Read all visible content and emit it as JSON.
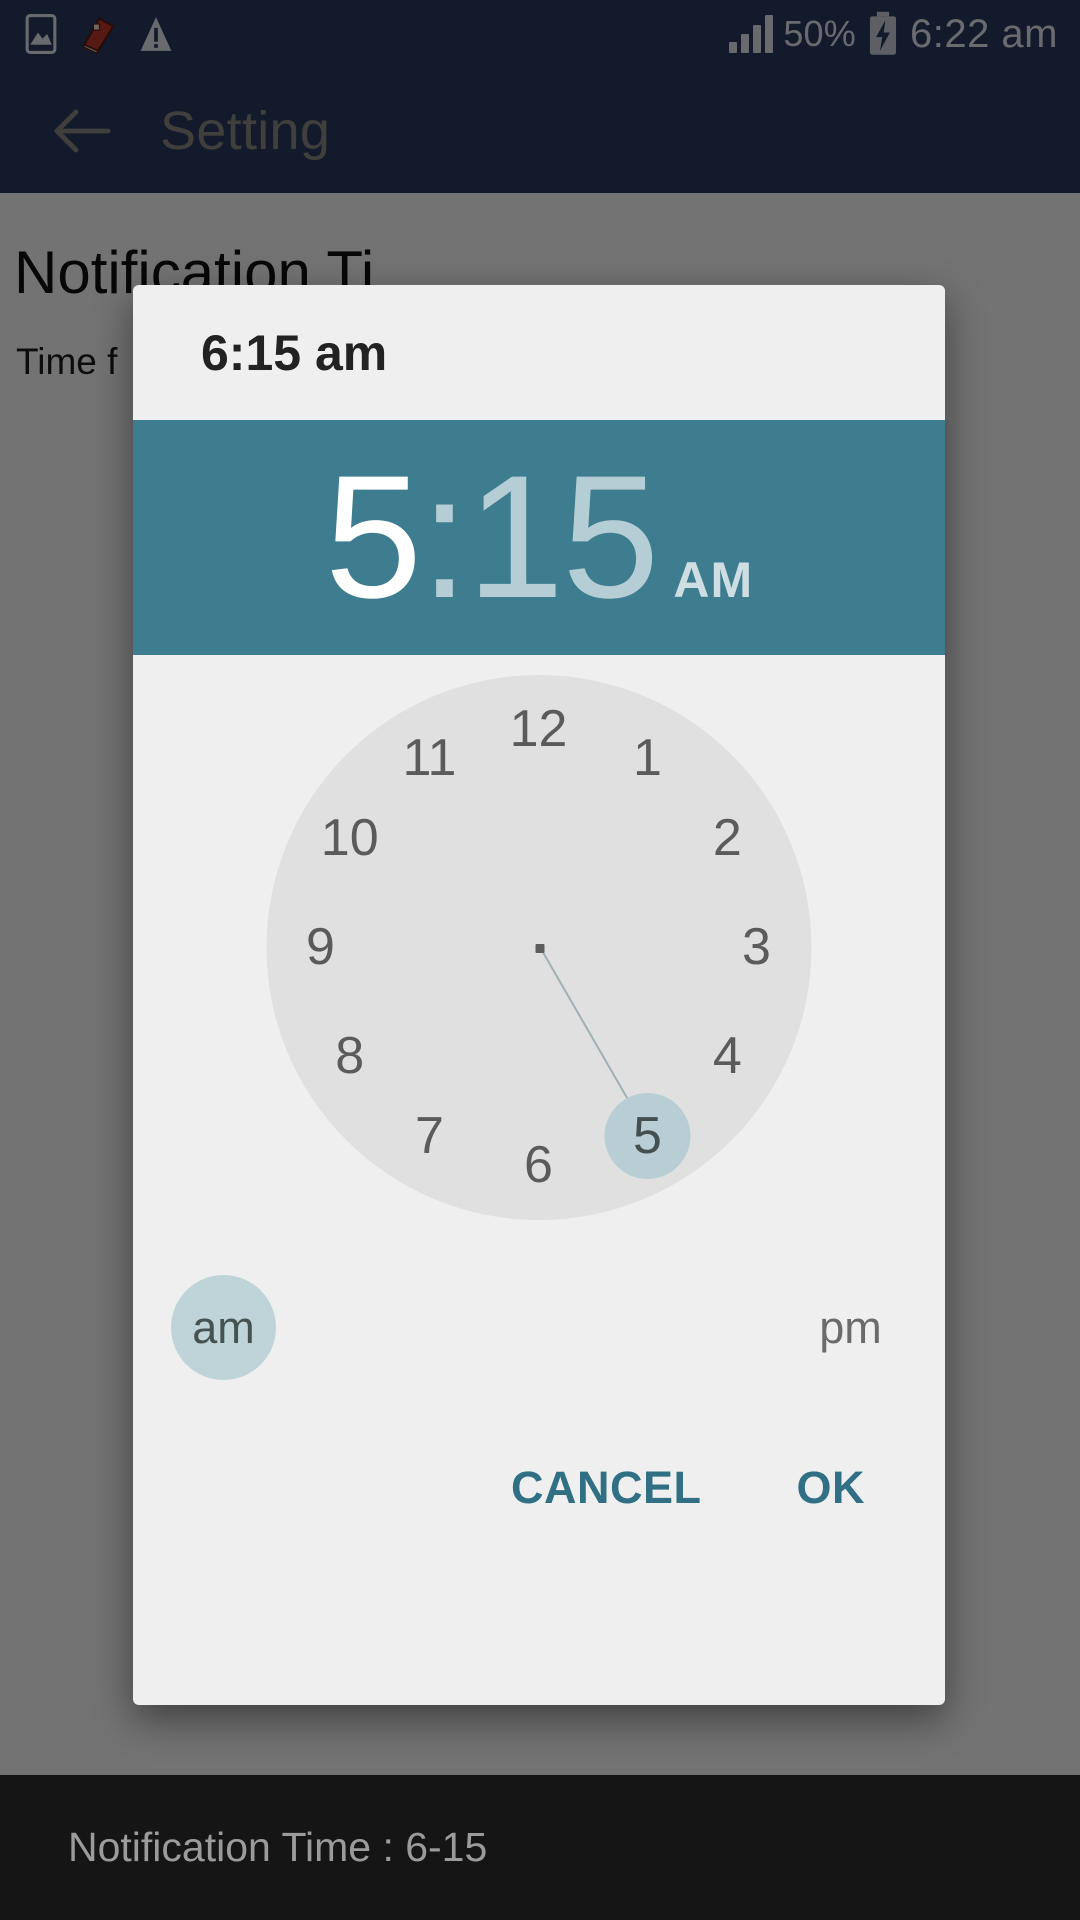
{
  "statusbar": {
    "icons": [
      "image-icon",
      "book-icon",
      "warning-icon"
    ],
    "battery_percent": "50%",
    "battery_icon": "battery-charging-icon",
    "signal_icon": "signal-bars-icon",
    "clock": "6:22 am"
  },
  "appbar": {
    "back_icon": "back-arrow-icon",
    "title": "Setting"
  },
  "content": {
    "preference_title": "Notification Ti",
    "preference_summary": "Time f"
  },
  "dialog": {
    "title": "6:15 am",
    "header": {
      "hour": "5",
      "colon": ":",
      "minute": "15",
      "ampm": "AM"
    },
    "clock": {
      "ticks": [
        "12",
        "1",
        "2",
        "3",
        "4",
        "5",
        "6",
        "7",
        "8",
        "9",
        "10",
        "11"
      ],
      "selected_tick": "5",
      "hand_target": "5"
    },
    "ampm": {
      "am_label": "am",
      "pm_label": "pm",
      "selected": "am"
    },
    "actions": {
      "cancel": "CANCEL",
      "ok": "OK"
    },
    "colors": {
      "header_teal": "#3d7d8f",
      "accent": "#317084",
      "selection": "#b9ced4",
      "face": "#e0e0e0",
      "surface": "#efefef"
    }
  },
  "snackbar": {
    "message": "Notification Time : 6-15"
  }
}
